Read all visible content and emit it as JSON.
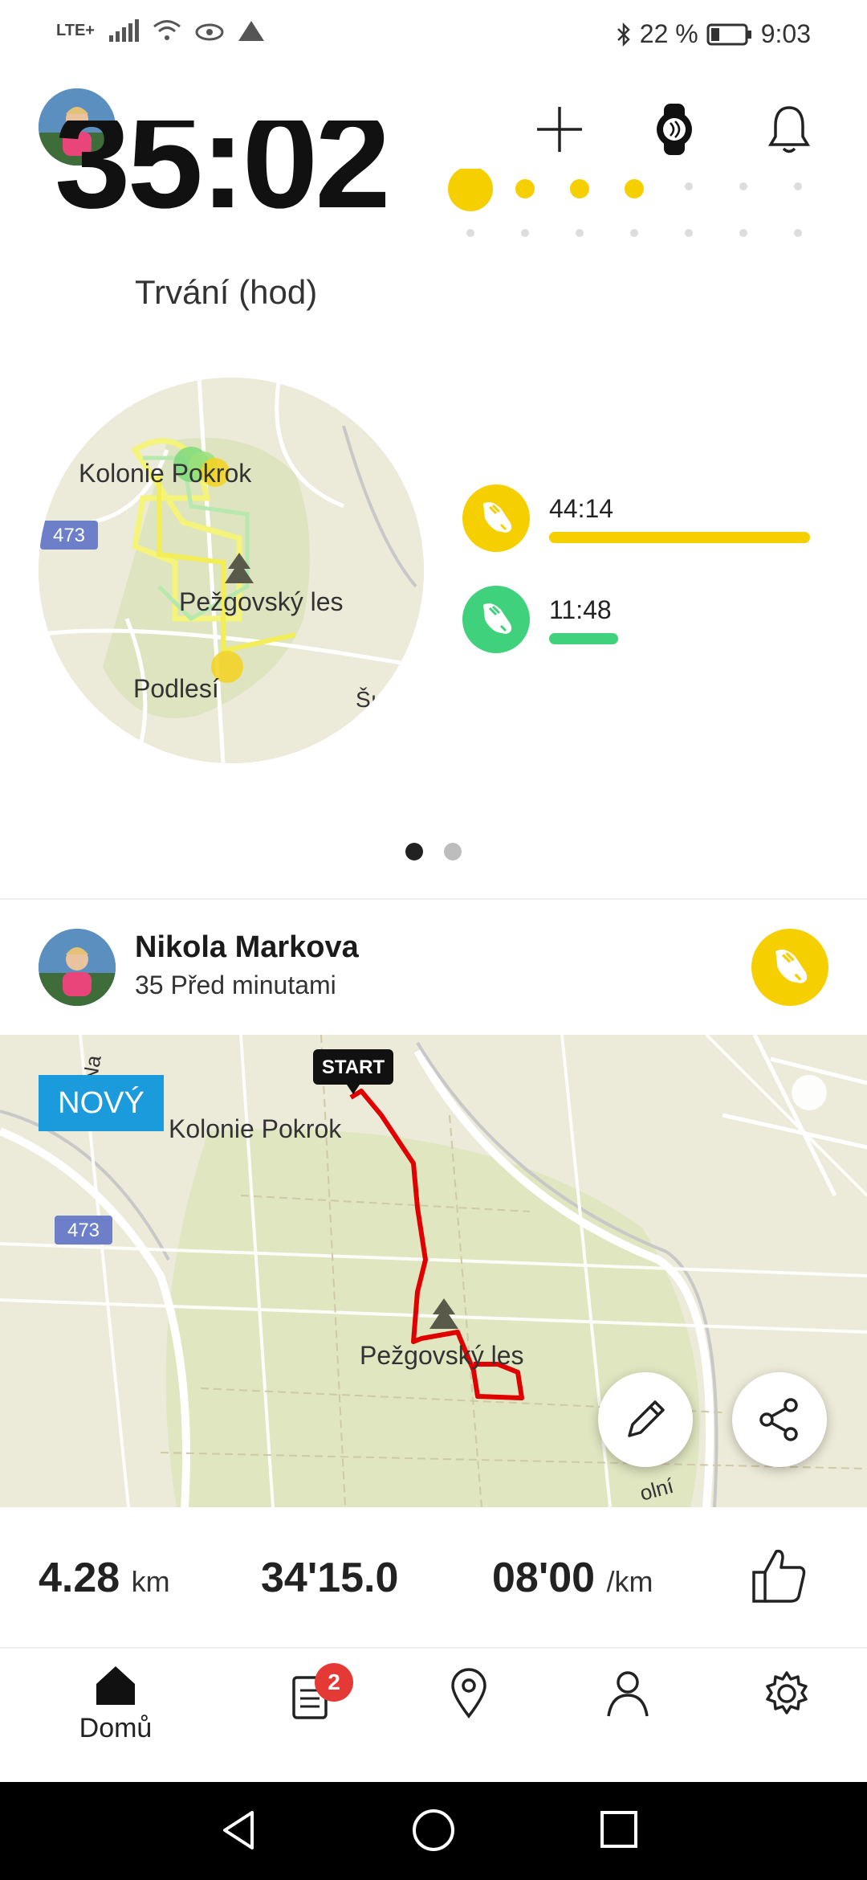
{
  "status_bar": {
    "network": "LTE+",
    "battery": "22 %",
    "time": "9:03",
    "icons": [
      "signal-icon",
      "wifi-icon",
      "eye-icon",
      "warning-icon",
      "bluetooth-icon",
      "battery-icon"
    ]
  },
  "header": {
    "actions": [
      "add-icon",
      "watch-icon",
      "bell-icon"
    ]
  },
  "summary": {
    "big_value": "35:02",
    "duration_label": "Trvání (hod)"
  },
  "map_summary": {
    "labels": {
      "kolonie": "Kolonie Pokrok",
      "road": "473",
      "forest": "Pežgovský les",
      "podlesi": "Podlesí",
      "edge": "Šı"
    }
  },
  "activity_stats": [
    {
      "icon": "running-shoe-icon",
      "value": "44:14",
      "color": "#f6cf00",
      "fraction": 1.0
    },
    {
      "icon": "walking-shoe-icon",
      "value": "11:48",
      "color": "#3fd17c",
      "fraction": 0.27
    }
  ],
  "pager": {
    "active": 0,
    "count": 2
  },
  "feed_item": {
    "name": "Nikola Markova",
    "time": "35 Před minutami",
    "badge": "NOVÝ",
    "map_labels": {
      "start": "START",
      "kolonie": "Kolonie Pokrok",
      "road": "473",
      "forest": "Pežgovský les",
      "street_left": "Na",
      "street_bottom": "olní"
    },
    "distance_value": "4.28",
    "distance_unit": "km",
    "duration_value": "34'15.0",
    "pace_value": "08'00",
    "pace_unit": "/km"
  },
  "bottom_nav": {
    "home_label": "Domů",
    "notification_count": "2",
    "items": [
      "home-icon",
      "feed-icon",
      "map-pin-icon",
      "profile-icon",
      "settings-icon"
    ]
  },
  "colors": {
    "accent_yellow": "#f6cf00",
    "accent_green": "#3fd17c",
    "route_red": "#e00000",
    "badge_blue": "#1c9bdc"
  }
}
